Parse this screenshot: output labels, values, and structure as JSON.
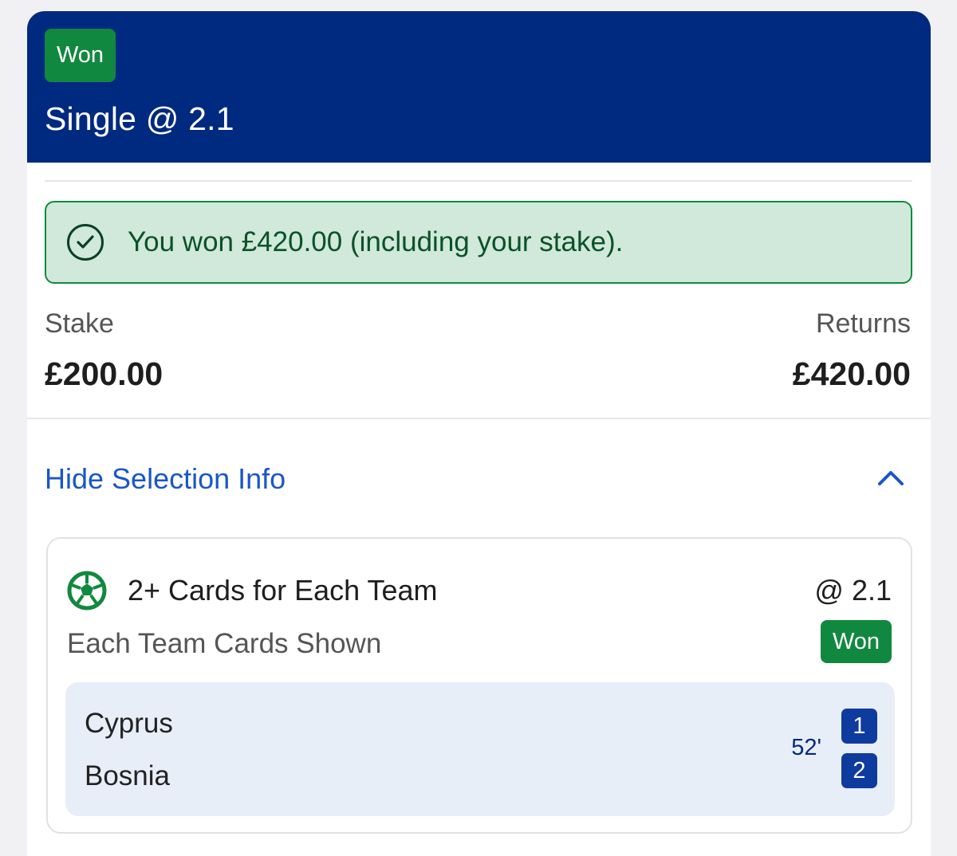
{
  "header": {
    "status_badge": "Won",
    "bet_title": "Single @ 2.1"
  },
  "win_banner": {
    "message": "You won £420.00 (including your stake)."
  },
  "summary": {
    "stake_label": "Stake",
    "stake_value": "£200.00",
    "returns_label": "Returns",
    "returns_value": "£420.00"
  },
  "selection_toggle": {
    "label": "Hide Selection Info",
    "icon": "chevron-up-icon"
  },
  "selection": {
    "sport_icon": "football-icon",
    "market": "2+ Cards for Each Team",
    "odds": "@ 2.1",
    "market_type": "Each Team Cards Shown",
    "status": "Won",
    "match": {
      "home_team": "Cyprus",
      "away_team": "Bosnia",
      "minute": "52'",
      "home_score": "1",
      "away_score": "2"
    }
  },
  "colors": {
    "header_bg": "#002980",
    "won_green": "#11883f",
    "banner_bg": "#d0e9da",
    "link_blue": "#1a56c8",
    "score_blue": "#0e3b9e"
  }
}
